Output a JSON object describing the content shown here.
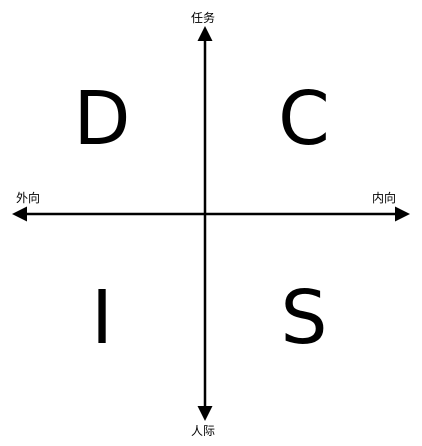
{
  "axes": {
    "top_label": "任务",
    "bottom_label": "人际",
    "left_label": "外向",
    "right_label": "内向"
  },
  "quadrants": {
    "top_left": "D",
    "top_right": "C",
    "bottom_left": "I",
    "bottom_right": "S"
  },
  "colors": {
    "line": "#000000",
    "text": "#000000",
    "background": "#ffffff"
  }
}
